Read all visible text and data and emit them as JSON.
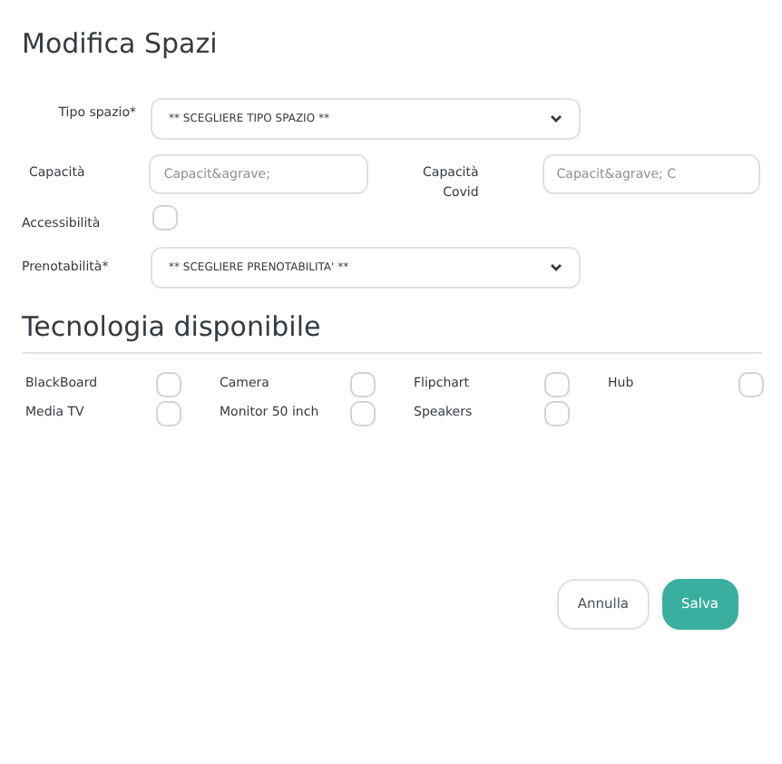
{
  "title": "Modifica Spazi",
  "form": {
    "tipo_spazio": {
      "label": "Tipo spazio*",
      "value": "** SCEGLIERE TIPO SPAZIO **"
    },
    "capacita": {
      "label": "Capacità",
      "placeholder": "Capacit&agrave;"
    },
    "capacita_covid": {
      "label": "Capacità Covid",
      "placeholder": "Capacit&agrave; C"
    },
    "accessibilita": {
      "label": "Accessibilità",
      "checked": false
    },
    "prenotabilita": {
      "label": "Prenotabilità*",
      "value": "** SCEGLIERE PRENOTABILITA' **"
    }
  },
  "section_title": "Tecnologia disponibile",
  "technologies": [
    {
      "label": "BlackBoard",
      "checked": false
    },
    {
      "label": "Camera",
      "checked": false
    },
    {
      "label": "Flipchart",
      "checked": false
    },
    {
      "label": "Hub",
      "checked": false
    },
    {
      "label": "Media TV",
      "checked": false
    },
    {
      "label": "Monitor 50 inch",
      "checked": false
    },
    {
      "label": "Speakers",
      "checked": false
    }
  ],
  "buttons": [
    {
      "label": "Annulla",
      "kind": "secondary"
    },
    {
      "label": "Salva",
      "kind": "primary"
    }
  ]
}
